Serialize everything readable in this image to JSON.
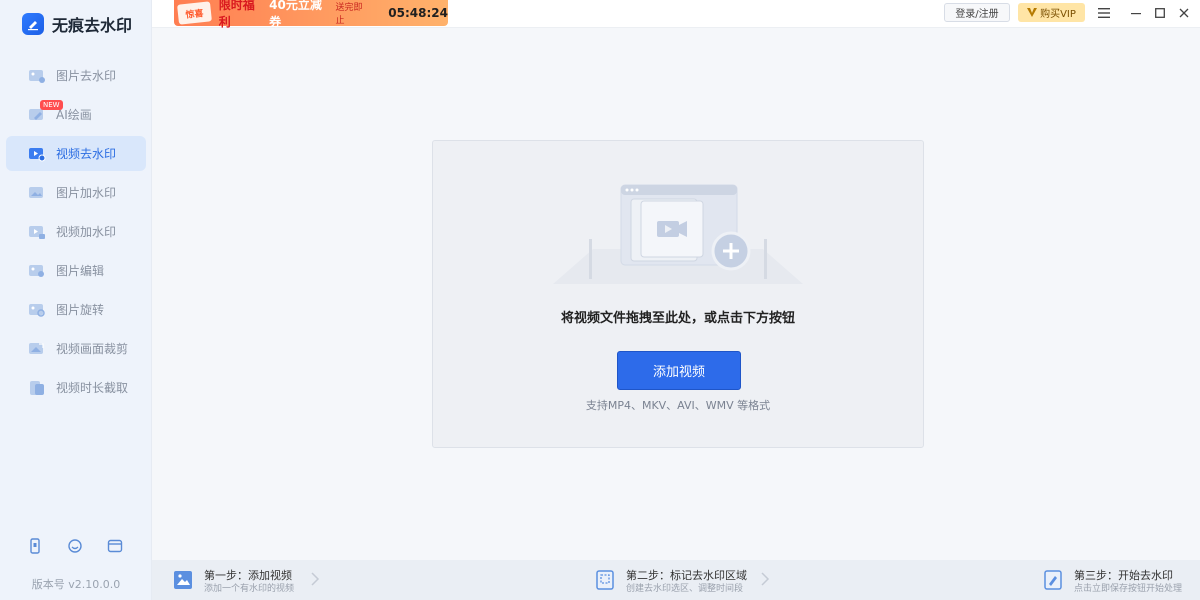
{
  "app": {
    "title": "无痕去水印",
    "version": "版本号 v2.10.0.0"
  },
  "promo": {
    "tag": "惊喜",
    "text": "限时福利",
    "highlight": "40元立减券",
    "sub": "送完即止",
    "timer": "05:48:24"
  },
  "topbar": {
    "login": "登录/注册",
    "vip": "购买VIP"
  },
  "sidebar": {
    "items": [
      {
        "label": "图片去水印",
        "icon": "image-eraser-icon",
        "active": false
      },
      {
        "label": "AI绘画",
        "icon": "ai-paint-icon",
        "active": false,
        "badge": "NEW"
      },
      {
        "label": "视频去水印",
        "icon": "video-eraser-icon",
        "active": true
      },
      {
        "label": "图片加水印",
        "icon": "image-watermark-icon",
        "active": false
      },
      {
        "label": "视频加水印",
        "icon": "video-watermark-icon",
        "active": false
      },
      {
        "label": "图片编辑",
        "icon": "image-edit-icon",
        "active": false
      },
      {
        "label": "图片旋转",
        "icon": "image-rotate-icon",
        "active": false
      },
      {
        "label": "视频画面裁剪",
        "icon": "video-crop-icon",
        "active": false
      },
      {
        "label": "视频时长截取",
        "icon": "video-trim-icon",
        "active": false
      }
    ]
  },
  "dropzone": {
    "hint": "将视频文件拖拽至此处，或点击下方按钮",
    "button": "添加视频",
    "formats": "支持MP4、MKV、AVI、WMV 等格式"
  },
  "steps": [
    {
      "title": "第一步：添加视频",
      "desc": "添加一个有水印的视频"
    },
    {
      "title": "第二步：标记去水印区域",
      "desc": "创建去水印选区、调整时间段"
    },
    {
      "title": "第三步：开始去水印",
      "desc": "点击立即保存按钮开始处理"
    }
  ],
  "colors": {
    "accent": "#2d6bea",
    "sidebar_bg": "#eef3fb",
    "active_bg": "#d9e7fb",
    "promo": "#ff7e52",
    "vip": "#ffe5a6"
  }
}
